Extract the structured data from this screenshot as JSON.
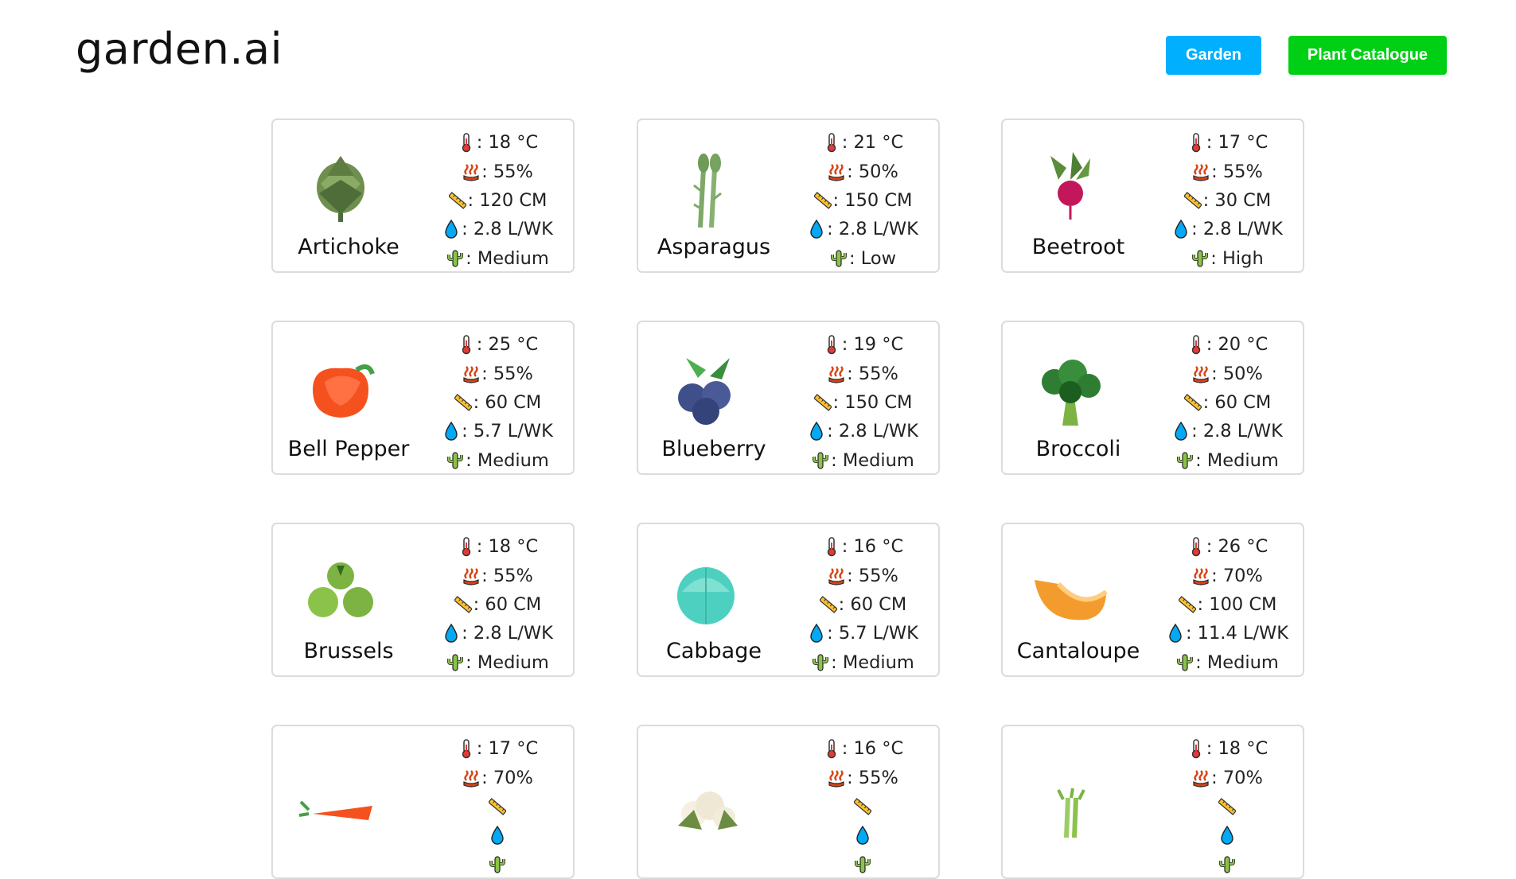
{
  "header": {
    "logo": "garden.ai",
    "nav": {
      "garden_label": "Garden",
      "catalogue_label": "Plant Catalogue"
    }
  },
  "colors": {
    "garden_button": "#00b0ff",
    "catalogue_button": "#00d015",
    "card_border": "#dcdcdc"
  },
  "stat_icons": [
    "thermometer-icon",
    "humidity-icon",
    "ruler-icon",
    "water-drop-icon",
    "cactus-icon"
  ],
  "plants": [
    {
      "name": "Artichoke",
      "temp": ": 18 °C",
      "humidity": ": 55%",
      "height": ": 120 CM",
      "water": ": 2.8 L/WK",
      "difficulty": ": Medium",
      "image": "artichoke"
    },
    {
      "name": "Asparagus",
      "temp": ": 21 °C",
      "humidity": ": 50%",
      "height": ": 150 CM",
      "water": ": 2.8 L/WK",
      "difficulty": ": Low",
      "image": "asparagus"
    },
    {
      "name": "Beetroot",
      "temp": ": 17 °C",
      "humidity": ": 55%",
      "height": ": 30 CM",
      "water": ": 2.8 L/WK",
      "difficulty": ": High",
      "image": "beetroot"
    },
    {
      "name": "Bell Pepper",
      "temp": ": 25 °C",
      "humidity": ": 55%",
      "height": ": 60 CM",
      "water": ": 5.7 L/WK",
      "difficulty": ": Medium",
      "image": "bell-pepper"
    },
    {
      "name": "Blueberry",
      "temp": ": 19 °C",
      "humidity": ": 55%",
      "height": ": 150 CM",
      "water": ": 2.8 L/WK",
      "difficulty": ": Medium",
      "image": "blueberry"
    },
    {
      "name": "Broccoli",
      "temp": ": 20 °C",
      "humidity": ": 50%",
      "height": ": 60 CM",
      "water": ": 2.8 L/WK",
      "difficulty": ": Medium",
      "image": "broccoli"
    },
    {
      "name": "Brussels",
      "temp": ": 18 °C",
      "humidity": ": 55%",
      "height": ": 60 CM",
      "water": ": 2.8 L/WK",
      "difficulty": ": Medium",
      "image": "brussels"
    },
    {
      "name": "Cabbage",
      "temp": ": 16 °C",
      "humidity": ": 55%",
      "height": ": 60 CM",
      "water": ": 5.7 L/WK",
      "difficulty": ": Medium",
      "image": "cabbage"
    },
    {
      "name": "Cantaloupe",
      "temp": ": 26 °C",
      "humidity": ": 70%",
      "height": ": 100 CM",
      "water": ": 11.4 L/WK",
      "difficulty": ": Medium",
      "image": "cantaloupe"
    },
    {
      "name": "",
      "temp": ": 17 °C",
      "humidity": ": 70%",
      "height": "",
      "water": "",
      "difficulty": "",
      "image": "carrot"
    },
    {
      "name": "",
      "temp": ": 16 °C",
      "humidity": ": 55%",
      "height": "",
      "water": "",
      "difficulty": "",
      "image": "cauliflower"
    },
    {
      "name": "",
      "temp": ": 18 °C",
      "humidity": ": 70%",
      "height": "",
      "water": "",
      "difficulty": "",
      "image": "celery"
    }
  ]
}
